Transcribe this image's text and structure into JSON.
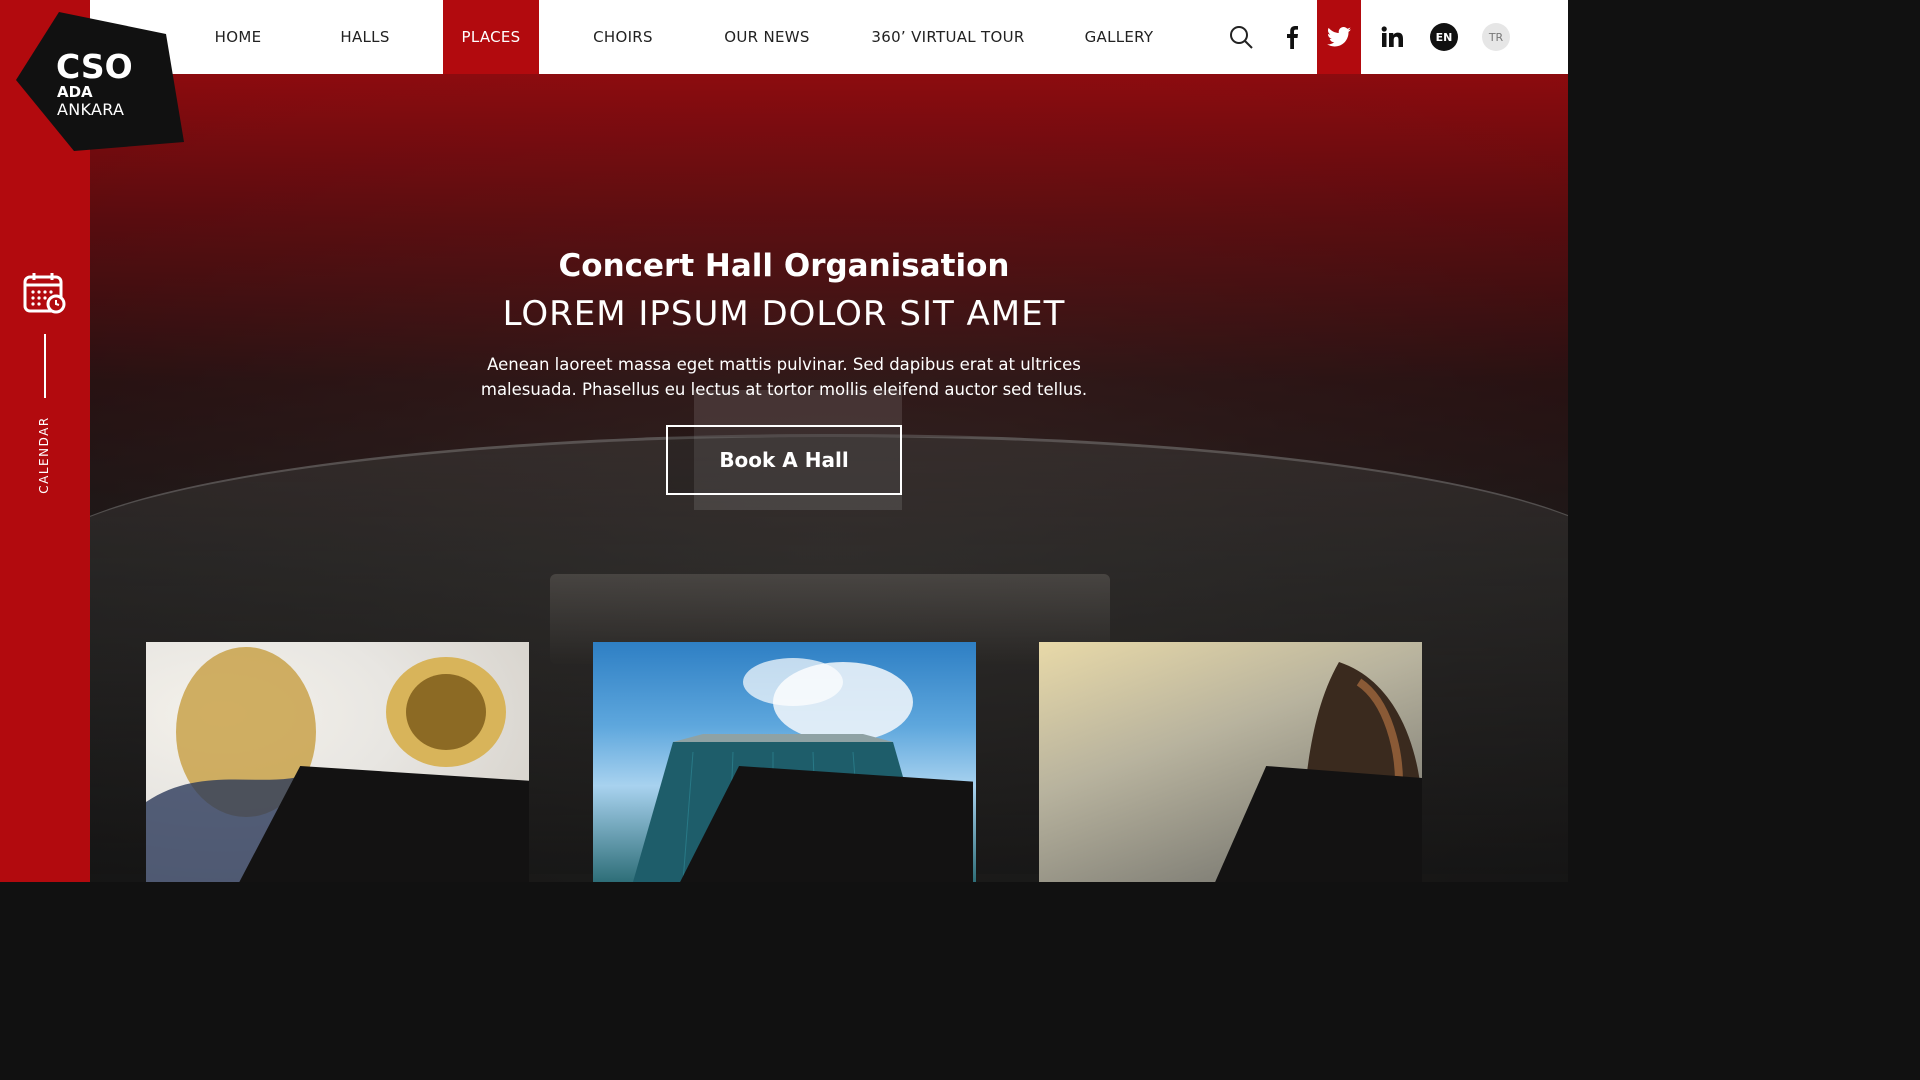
{
  "logo": {
    "line1": "CSO",
    "line2": "ADA",
    "line3": "ANKARA"
  },
  "nav": {
    "items": [
      {
        "label": "HOME"
      },
      {
        "label": "HALLS"
      },
      {
        "label": "PLACES",
        "active": true
      },
      {
        "label": "CHOIRS"
      },
      {
        "label": "OUR NEWS"
      },
      {
        "label": "360’ VIRTUAL TOUR"
      },
      {
        "label": "GALLERY"
      }
    ],
    "icons": [
      "search-icon",
      "facebook-icon",
      "twitter-icon",
      "linkedin-icon"
    ],
    "languages": [
      {
        "code": "EN",
        "active": true
      },
      {
        "code": "TR",
        "active": false
      }
    ]
  },
  "sidebar": {
    "calendar_label": "CALENDAR",
    "icon": "calendar-icon"
  },
  "hero": {
    "title": "Concert Hall Organisation",
    "subtitle": "LOREM IPSUM DOLOR SIT AMET",
    "text": "Aenean laoreet massa eget mattis pulvinar. Sed dapibus erat at ultrices malesuada. Phasellus eu lectus at tortor mollis eleifend auctor sed tellus.",
    "button": "Book A Hall"
  },
  "cards": [
    {
      "image": "brass-instruments"
    },
    {
      "image": "glass-building"
    },
    {
      "image": "violin"
    }
  ],
  "colors": {
    "brand_red": "#b20a0e",
    "black": "#111111",
    "white": "#ffffff"
  }
}
